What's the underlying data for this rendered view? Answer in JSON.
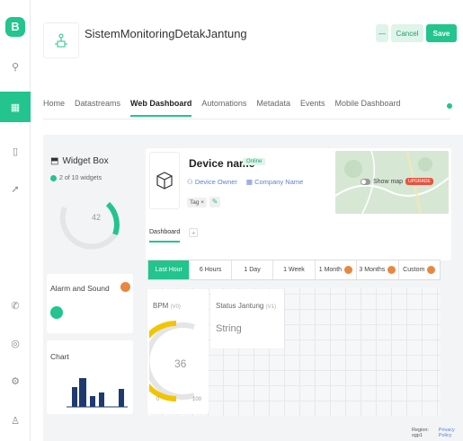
{
  "app": {
    "logo_letter": "B"
  },
  "header": {
    "title": "SistemMonitoringDetakJantung",
    "minus_label": "—",
    "cancel_label": "Cancel",
    "save_label": "Save"
  },
  "tabs": [
    {
      "label": "Home"
    },
    {
      "label": "Datastreams"
    },
    {
      "label": "Web Dashboard",
      "active": true
    },
    {
      "label": "Automations"
    },
    {
      "label": "Metadata"
    },
    {
      "label": "Events"
    },
    {
      "label": "Mobile Dashboard"
    }
  ],
  "widget_box": {
    "title": "Widget Box",
    "subtitle": "2 of 10 widgets",
    "gauge_value": "42",
    "alarm_label": "Alarm and Sound",
    "chart_label": "Chart"
  },
  "device": {
    "name": "Device name",
    "status": "Online",
    "owner": "Device Owner",
    "company": "Company Name",
    "tag": "Tag",
    "show_map": "Show map",
    "upgrade": "UPGRADE",
    "subtab": "Dashboard",
    "subtab_add": "+"
  },
  "time_range": [
    "Last Hour",
    "6 Hours",
    "1 Day",
    "1 Week",
    "1 Month",
    "3 Months",
    "Custom"
  ],
  "widgets": {
    "bpm_title": "BPM",
    "bpm_pin": "(V0)",
    "bpm_value": "36",
    "bpm_min": "0",
    "bpm_max": "100",
    "status_title": "Status Jantung",
    "status_pin": "(V1)",
    "status_value": "String"
  },
  "footer": {
    "region": "Region: sgp1",
    "privacy": "Privacy Policy"
  },
  "colors": {
    "accent": "#23c48e",
    "gauge_yellow": "#f2c500",
    "lock": "#e8873f"
  }
}
